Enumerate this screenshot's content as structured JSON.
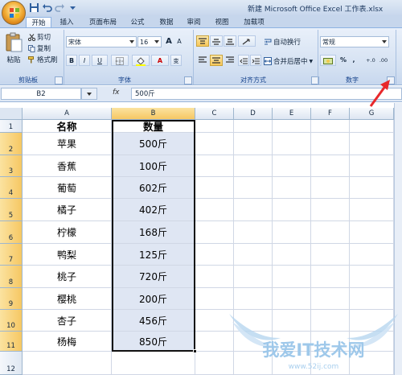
{
  "window": {
    "title": "新建 Microsoft Office Excel 工作表.xlsx"
  },
  "ribbon_tabs": [
    "开始",
    "插入",
    "页面布局",
    "公式",
    "数据",
    "审阅",
    "视图",
    "加载项"
  ],
  "clipboard": {
    "paste_label": "粘贴",
    "cut_label": "剪切",
    "copy_label": "复制",
    "format_painter_label": "格式刷",
    "group_label": "剪贴板"
  },
  "font": {
    "font_name": "宋体",
    "font_size": "16",
    "bold": "B",
    "italic": "I",
    "underline": "U",
    "grow": "A",
    "shrink": "A",
    "font_color_glyph": "A",
    "change_case": "变",
    "group_label": "字体"
  },
  "alignment": {
    "wrap_text_label": "自动换行",
    "merge_center_label": "合并后居中",
    "group_label": "对齐方式"
  },
  "number": {
    "format_value": "常规",
    "percent": "%",
    "comma": ",",
    "inc_decimal": "+.0",
    "dec_decimal": ".00",
    "group_label": "数字"
  },
  "formula_bar": {
    "name_box": "B2",
    "fx_label": "fx",
    "formula_value": "500斤"
  },
  "sheet": {
    "columns": [
      "A",
      "B",
      "C",
      "D",
      "E",
      "F",
      "G"
    ],
    "row_numbers": [
      "1",
      "2",
      "3",
      "4",
      "5",
      "6",
      "7",
      "8",
      "9",
      "10",
      "11",
      "12"
    ],
    "header_a": "名称",
    "header_b": "数量",
    "rows": [
      {
        "name": "苹果",
        "qty": "500斤"
      },
      {
        "name": "香蕉",
        "qty": "100斤"
      },
      {
        "name": "葡萄",
        "qty": "602斤"
      },
      {
        "name": "橘子",
        "qty": "402斤"
      },
      {
        "name": "柠檬",
        "qty": "168斤"
      },
      {
        "name": "鸭梨",
        "qty": "125斤"
      },
      {
        "name": "桃子",
        "qty": "720斤"
      },
      {
        "name": "樱桃",
        "qty": "200斤"
      },
      {
        "name": "杏子",
        "qty": "456斤"
      },
      {
        "name": "杨梅",
        "qty": "850斤"
      }
    ]
  },
  "watermark": {
    "text": "我爱IT技术网",
    "url": "www.52ij.com"
  },
  "colors": {
    "selection_fill": "#dfe6f3",
    "annotation_arrow": "#e8282b",
    "watermark": "#9ec8ea"
  }
}
